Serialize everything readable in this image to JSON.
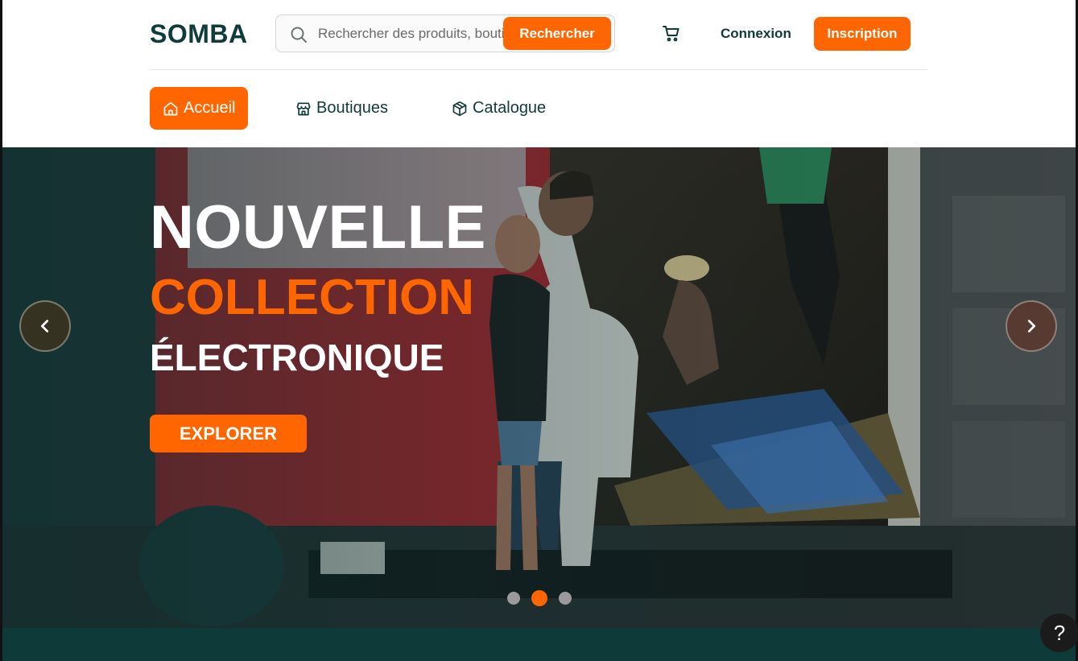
{
  "brand": {
    "name": "SOMBA",
    "accent": "#ff6600",
    "primary": "#0f3b3a"
  },
  "search": {
    "placeholder": "Rechercher des produits, boutiques...",
    "value": "",
    "button_label": "Rechercher"
  },
  "header": {
    "cart_icon": "cart-icon",
    "login_label": "Connexion",
    "signup_label": "Inscription"
  },
  "nav": {
    "items": [
      {
        "label": "Accueil",
        "icon": "home-icon",
        "active": true
      },
      {
        "label": "Boutiques",
        "icon": "store-icon",
        "active": false
      },
      {
        "label": "Catalogue",
        "icon": "box-icon",
        "active": false
      }
    ]
  },
  "hero": {
    "line1": "NOUVELLE",
    "line2": "COLLECTION",
    "line3": "ÉLECTRONIQUE",
    "cta_label": "EXPLORER",
    "slide_count": 3,
    "active_slide": 2
  },
  "help": {
    "label": "?"
  }
}
